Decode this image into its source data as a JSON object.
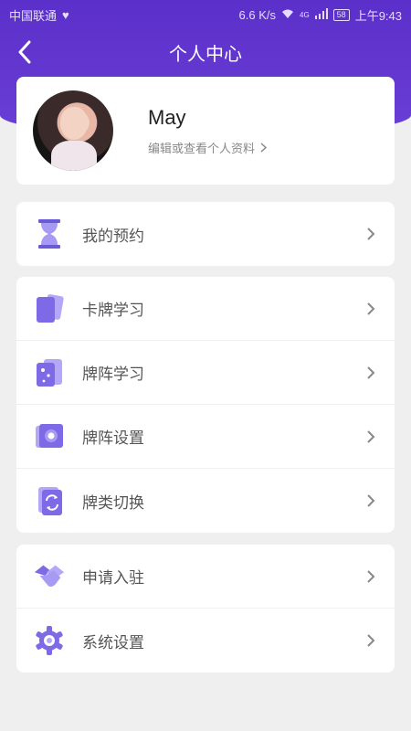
{
  "status_bar": {
    "carrier": "中国联通",
    "speed": "6.6 K/s",
    "network": "4G",
    "battery": "58",
    "time": "上午9:43"
  },
  "nav": {
    "title": "个人中心"
  },
  "profile": {
    "name": "May",
    "subtitle": "编辑或查看个人资料"
  },
  "groups": [
    {
      "items": [
        {
          "label": "我的预约",
          "icon": "hourglass-icon"
        }
      ]
    },
    {
      "items": [
        {
          "label": "卡牌学习",
          "icon": "cards-moon-icon"
        },
        {
          "label": "牌阵学习",
          "icon": "cards-star-icon"
        },
        {
          "label": "牌阵设置",
          "icon": "spread-settings-icon"
        },
        {
          "label": "牌类切换",
          "icon": "switch-cards-icon"
        }
      ]
    },
    {
      "items": [
        {
          "label": "申请入驻",
          "icon": "handshake-icon"
        },
        {
          "label": "系统设置",
          "icon": "gear-icon"
        }
      ]
    }
  ],
  "colors": {
    "accent": "#6a3fd6",
    "icon": "#8e7cf0",
    "background": "#efefef"
  }
}
